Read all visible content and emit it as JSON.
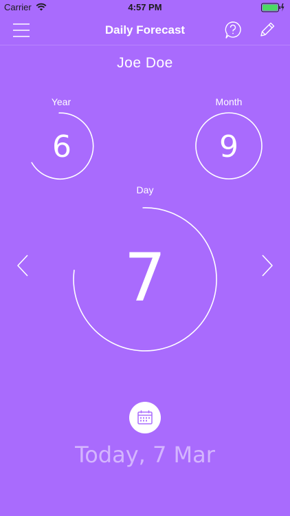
{
  "status_bar": {
    "carrier": "Carrier",
    "time": "4:57 PM"
  },
  "nav": {
    "title": "Daily Forecast"
  },
  "user": {
    "name": "Joe Doe"
  },
  "year": {
    "label": "Year",
    "value": "6"
  },
  "month": {
    "label": "Month",
    "value": "9"
  },
  "day": {
    "label": "Day",
    "value": "7"
  },
  "footer": {
    "date": "Today, 7 Mar"
  },
  "colors": {
    "background": "#A96BFD",
    "foreground": "#FFFFFF",
    "accent": "#A96BFD"
  },
  "icons": [
    "menu-icon",
    "help-icon",
    "pencil-icon",
    "chevron-left-icon",
    "chevron-right-icon",
    "calendar-icon",
    "wifi-icon",
    "battery-icon"
  ]
}
